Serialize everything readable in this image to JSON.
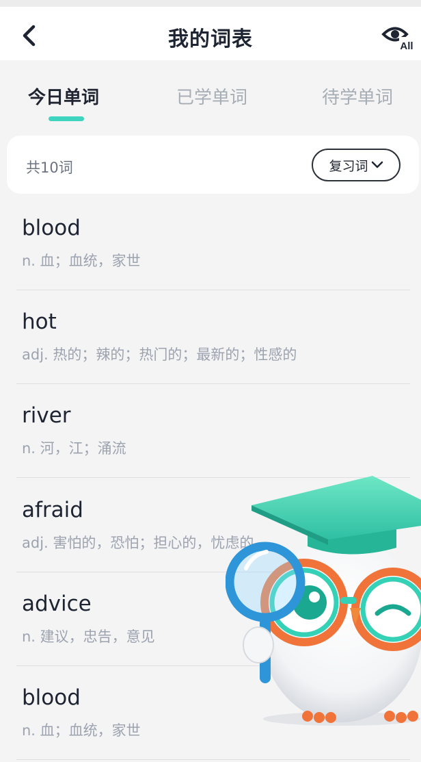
{
  "header": {
    "title": "我的词表"
  },
  "tabs": [
    {
      "label": "今日单词",
      "active": true
    },
    {
      "label": "已学单词",
      "active": false
    },
    {
      "label": "待学单词",
      "active": false
    }
  ],
  "summary": {
    "count_label": "共10词",
    "filter_label": "复习词"
  },
  "words": [
    {
      "word": "blood",
      "meaning": "n. 血；血统，家世"
    },
    {
      "word": "hot",
      "meaning": "adj. 热的；辣的；热门的；最新的；性感的"
    },
    {
      "word": "river",
      "meaning": "n. 河，江；涌流"
    },
    {
      "word": "afraid",
      "meaning": "adj. 害怕的，恐怕；担心的，忧虑的"
    },
    {
      "word": "advice",
      "meaning": "n. 建议，忠告，意见"
    },
    {
      "word": "blood",
      "meaning": "n. 血；血统，家世"
    }
  ],
  "icons": {
    "back": "chevron-left-icon",
    "eye": "eye-all-icon",
    "dropdown": "chevron-down-icon",
    "mascot": "owl-mascot-illustration"
  },
  "colors": {
    "accent": "#3fd4c0",
    "title": "#1e2432",
    "muted": "#9ca3af"
  }
}
